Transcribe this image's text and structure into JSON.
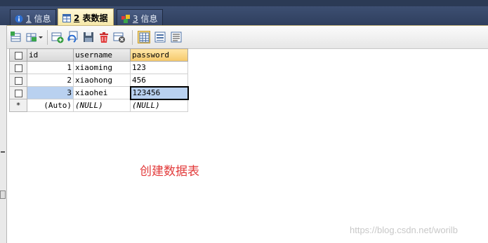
{
  "tabs": [
    {
      "label_num": "1",
      "label_text": " 信息",
      "icon": "info-icon"
    },
    {
      "label_num": "2",
      "label_text": " 表数据",
      "icon": "table-icon"
    },
    {
      "label_num": "3",
      "label_text": " 信息",
      "icon": "info-icon"
    }
  ],
  "toolbar": {
    "icons": [
      "insert-row-icon",
      "insert-dropdown-icon",
      "add-row-icon",
      "refresh-icon",
      "save-icon",
      "delete-icon",
      "cancel-icon",
      "grid-view-icon",
      "form-view-icon",
      "text-view-icon"
    ]
  },
  "grid": {
    "columns": [
      "id",
      "username",
      "password"
    ],
    "rows": [
      {
        "id": "1",
        "username": "xiaoming",
        "password": "123"
      },
      {
        "id": "2",
        "username": "xiaohong",
        "password": "456"
      },
      {
        "id": "3",
        "username": "xiaohei",
        "password": "123456"
      }
    ],
    "new_row": {
      "marker": "*",
      "id": "(Auto)",
      "username": "(NULL)",
      "password": "(NULL)"
    }
  },
  "note": "创建数据表",
  "watermark": "https://blog.csdn.net/worilb",
  "colors": {
    "tabbar": "#3d4f72",
    "active_tab": "#f5e7a8",
    "selection": "#b9d1f0",
    "note": "#e23a3a"
  }
}
